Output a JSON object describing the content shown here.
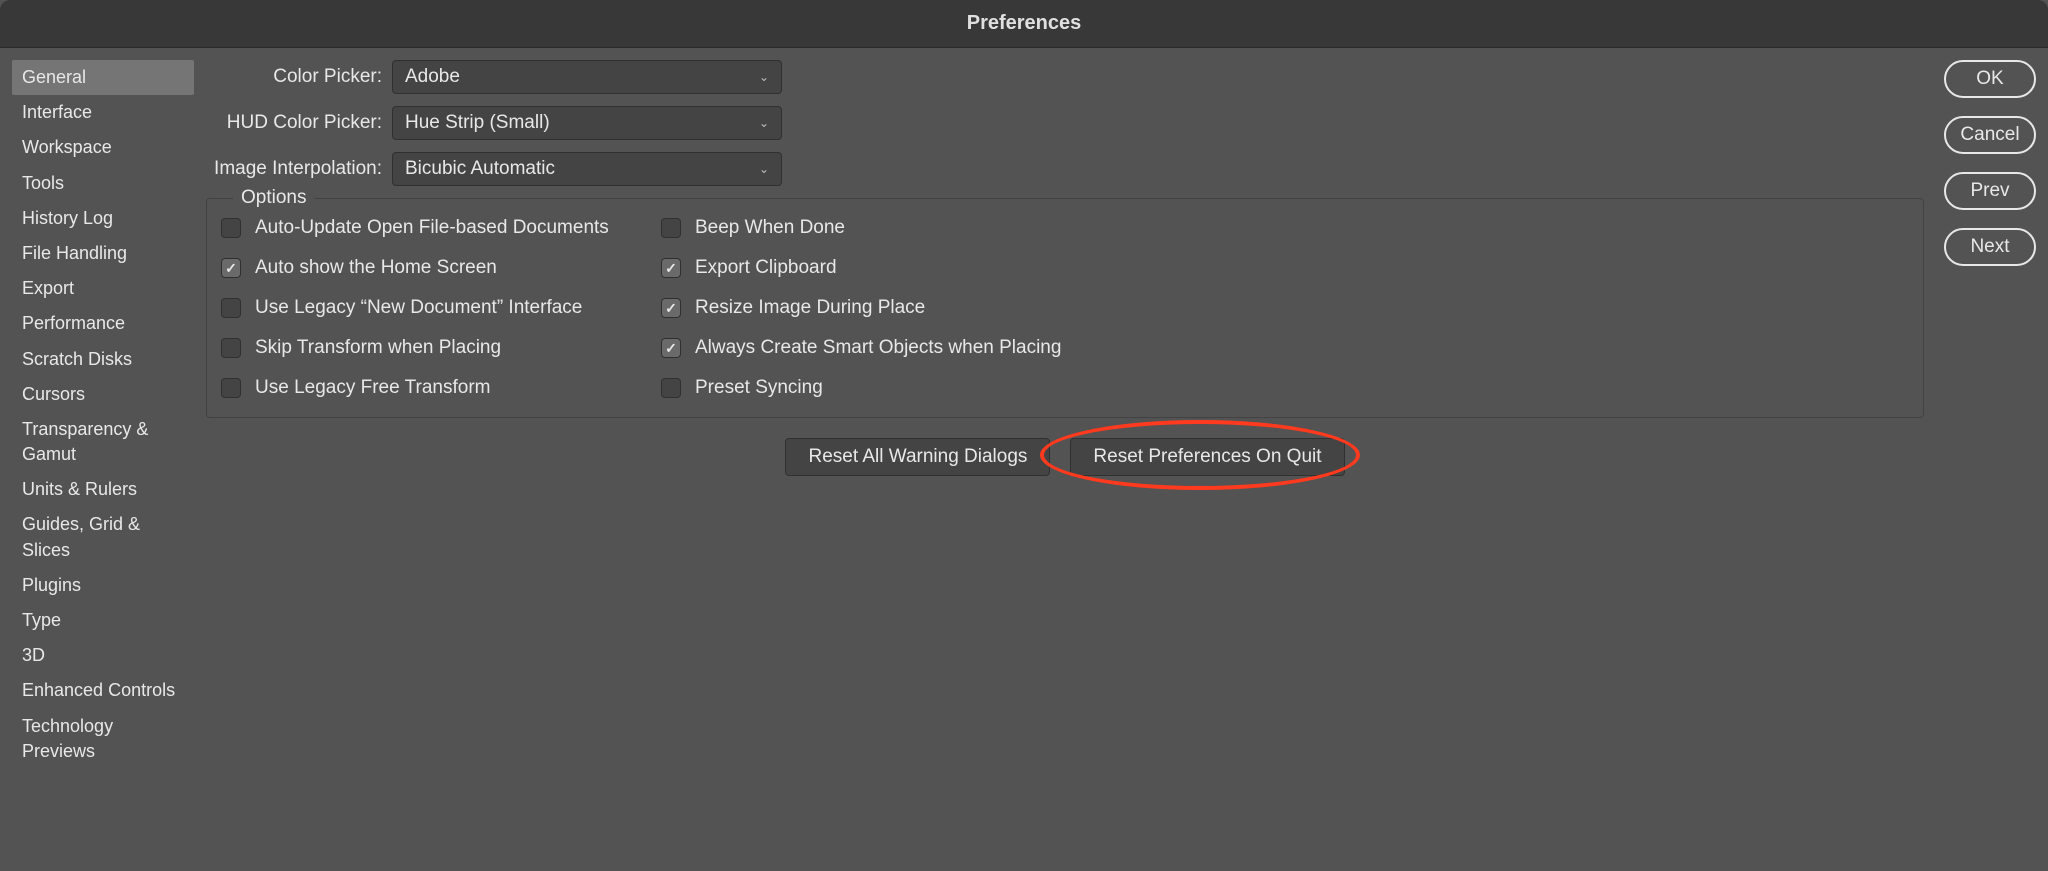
{
  "window": {
    "title": "Preferences"
  },
  "sidebar": {
    "items": [
      {
        "label": "General",
        "selected": true
      },
      {
        "label": "Interface"
      },
      {
        "label": "Workspace"
      },
      {
        "label": "Tools"
      },
      {
        "label": "History Log"
      },
      {
        "label": "File Handling"
      },
      {
        "label": "Export"
      },
      {
        "label": "Performance"
      },
      {
        "label": "Scratch Disks"
      },
      {
        "label": "Cursors"
      },
      {
        "label": "Transparency & Gamut"
      },
      {
        "label": "Units & Rulers"
      },
      {
        "label": "Guides, Grid & Slices"
      },
      {
        "label": "Plugins"
      },
      {
        "label": "Type"
      },
      {
        "label": "3D"
      },
      {
        "label": "Enhanced Controls"
      },
      {
        "label": "Technology Previews"
      }
    ]
  },
  "dropdowns": {
    "colorPicker": {
      "label": "Color Picker:",
      "value": "Adobe"
    },
    "hudColorPicker": {
      "label": "HUD Color Picker:",
      "value": "Hue Strip (Small)"
    },
    "imageInterpolation": {
      "label": "Image Interpolation:",
      "value": "Bicubic Automatic"
    }
  },
  "options": {
    "legend": "Options",
    "left": [
      {
        "label": "Auto-Update Open File-based Documents",
        "checked": false
      },
      {
        "label": "Auto show the Home Screen",
        "checked": true
      },
      {
        "label": "Use Legacy “New Document” Interface",
        "checked": false
      },
      {
        "label": "Skip Transform when Placing",
        "checked": false
      },
      {
        "label": "Use Legacy Free Transform",
        "checked": false
      }
    ],
    "right": [
      {
        "label": "Beep When Done",
        "checked": false
      },
      {
        "label": "Export Clipboard",
        "checked": true
      },
      {
        "label": "Resize Image During Place",
        "checked": true
      },
      {
        "label": "Always Create Smart Objects when Placing",
        "checked": true
      },
      {
        "label": "Preset Syncing",
        "checked": false
      }
    ]
  },
  "bottomButtons": {
    "resetWarnings": "Reset All Warning Dialogs",
    "resetPrefs": "Reset Preferences On Quit"
  },
  "rightButtons": {
    "ok": "OK",
    "cancel": "Cancel",
    "prev": "Prev",
    "next": "Next"
  }
}
